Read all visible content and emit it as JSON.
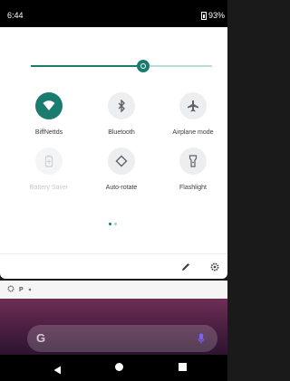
{
  "status_bar": {
    "time": "6:44",
    "battery": "93%"
  },
  "brightness": {
    "level": 0.62
  },
  "tiles": [
    {
      "label": "BiffNettds",
      "state": "on",
      "icon": "wifi-icon"
    },
    {
      "label": "Bluetooth",
      "state": "off",
      "icon": "bluetooth-icon"
    },
    {
      "label": "Airplane mode",
      "state": "off",
      "icon": "airplane-icon"
    },
    {
      "label": "Battery Saver",
      "state": "disabled",
      "icon": "battery-saver-icon"
    },
    {
      "label": "Auto-rotate",
      "state": "off",
      "icon": "auto-rotate-icon"
    },
    {
      "label": "Flashlight",
      "state": "off",
      "icon": "flashlight-icon"
    }
  ],
  "pager": {
    "count": 2,
    "active": 0
  },
  "notification_strip": {
    "icons": [
      "gear-icon",
      "parking-icon",
      "dot-icon"
    ]
  },
  "colors": {
    "accent": "#1a7c6f",
    "panel": "#ffffff",
    "status": "#000000"
  }
}
